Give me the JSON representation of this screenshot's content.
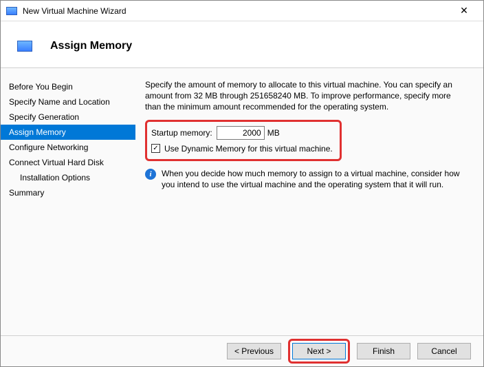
{
  "titlebar": {
    "title": "New Virtual Machine Wizard",
    "close_glyph": "✕"
  },
  "header": {
    "title": "Assign Memory"
  },
  "sidebar": {
    "items": [
      {
        "label": "Before You Begin"
      },
      {
        "label": "Specify Name and Location"
      },
      {
        "label": "Specify Generation"
      },
      {
        "label": "Assign Memory"
      },
      {
        "label": "Configure Networking"
      },
      {
        "label": "Connect Virtual Hard Disk"
      },
      {
        "label": "Installation Options"
      },
      {
        "label": "Summary"
      }
    ],
    "active_index": 3,
    "sub_indices": [
      6
    ]
  },
  "content": {
    "description": "Specify the amount of memory to allocate to this virtual machine. You can specify an amount from 32 MB through 251658240 MB. To improve performance, specify more than the minimum amount recommended for the operating system.",
    "startup_label": "Startup memory:",
    "startup_value": "2000",
    "startup_unit": "MB",
    "dynamic_checked": true,
    "dynamic_label": "Use Dynamic Memory for this virtual machine.",
    "info_text": "When you decide how much memory to assign to a virtual machine, consider how you intend to use the virtual machine and the operating system that it will run."
  },
  "footer": {
    "previous": "< Previous",
    "next": "Next >",
    "finish": "Finish",
    "cancel": "Cancel"
  }
}
